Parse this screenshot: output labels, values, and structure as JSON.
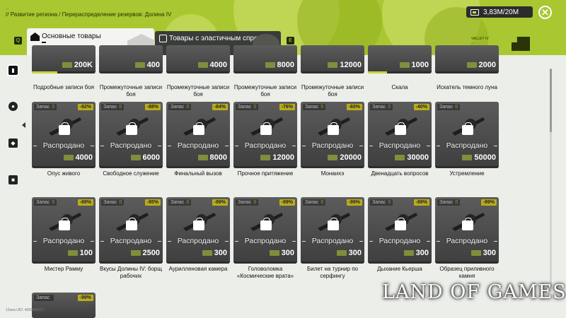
{
  "header": {
    "tiny_top": "...",
    "breadcrumb": [
      "//",
      "Развитие региона",
      "/",
      "Перераспределение резервов: Долина IV"
    ],
    "credits": "3,83M/20M",
    "close_icon": "close-icon"
  },
  "tabs": [
    {
      "label": "Основные товары",
      "icon": "house-icon",
      "active": true
    },
    {
      "label": "Товары с эластичным спросом",
      "icon": "chart-icon",
      "active": false
    }
  ],
  "key_hints": {
    "left": "Q",
    "right": "E"
  },
  "region_logo": {
    "line1": "VALLEY IV",
    "line2": "..."
  },
  "sidebar": {
    "items": [
      "box-icon",
      "gear-icon",
      "gem-icon",
      "package-icon"
    ]
  },
  "stock_label": "Запас",
  "sold_out_label": "Распродано",
  "rows": [
    {
      "kind": "partial",
      "items": [
        {
          "name": "Подробные записи боя",
          "price": "200K",
          "bar": 0.4
        },
        {
          "name": "Промежуточные записи боя",
          "price": "400",
          "bar": 0.0
        },
        {
          "name": "Промежуточные записи боя",
          "price": "4000",
          "bar": 0.0
        },
        {
          "name": "Промежуточные записи боя",
          "price": "8000",
          "bar": 0.0
        },
        {
          "name": "Промежуточные записи боя",
          "price": "12000",
          "bar": 0.0
        },
        {
          "name": "Скала",
          "price": "1000",
          "bar": 0.3
        },
        {
          "name": "Искатель темного луна",
          "price": "2000",
          "bar": 0.0
        }
      ]
    },
    {
      "kind": "full",
      "items": [
        {
          "name": "Опус живого",
          "stock": "0",
          "discount": "-92%",
          "price": "4000",
          "bar": 0.0
        },
        {
          "name": "Свободное служение",
          "stock": "0",
          "discount": "-88%",
          "price": "6000",
          "bar": 0.0
        },
        {
          "name": "Финальный вызов",
          "stock": "0",
          "discount": "-84%",
          "price": "8000",
          "bar": 0.0
        },
        {
          "name": "Прочное притяжение",
          "stock": "0",
          "discount": "-76%",
          "price": "12000",
          "bar": 0.0
        },
        {
          "name": "Монаихэ",
          "stock": "0",
          "discount": "-60%",
          "price": "20000",
          "bar": 0.0
        },
        {
          "name": "Двенадцать вопросов",
          "stock": "0",
          "discount": "-40%",
          "price": "30000",
          "bar": 0.0
        },
        {
          "name": "Устремление",
          "stock": "0",
          "discount": "",
          "price": "50000",
          "bar": 0.0
        }
      ]
    },
    {
      "kind": "full",
      "items": [
        {
          "name": "Мистер Рамму",
          "stock": "0",
          "discount": "-99%",
          "price": "100",
          "bar": 0.0
        },
        {
          "name": "Вкусы Долины IV: борщ рабочих",
          "stock": "0",
          "discount": "-95%",
          "price": "2500",
          "bar": 0.0
        },
        {
          "name": "Аурилленовая камера",
          "stock": "0",
          "discount": "-99%",
          "price": "300",
          "bar": 0.0
        },
        {
          "name": "Головоломка «Космические врата»",
          "stock": "0",
          "discount": "-99%",
          "price": "300",
          "bar": 0.0
        },
        {
          "name": "Билет на турнир по серфингу",
          "stock": "0",
          "discount": "-99%",
          "price": "300",
          "bar": 0.0
        },
        {
          "name": "Дыхание Кьерша",
          "stock": "0",
          "discount": "-99%",
          "price": "300",
          "bar": 0.0
        },
        {
          "name": "Образец приливного камня",
          "stock": "0",
          "discount": "-99%",
          "price": "300",
          "bar": 0.0
        }
      ]
    },
    {
      "kind": "stub",
      "items": [
        {
          "stock": "",
          "discount": "-99%"
        }
      ]
    }
  ],
  "footer": "12ana    UID: 4069883237",
  "watermark": "LAND OF GAMES",
  "colors": {
    "accent": "#a9c730",
    "card": "#4f4f4f",
    "discount": "#b9ad1a"
  }
}
